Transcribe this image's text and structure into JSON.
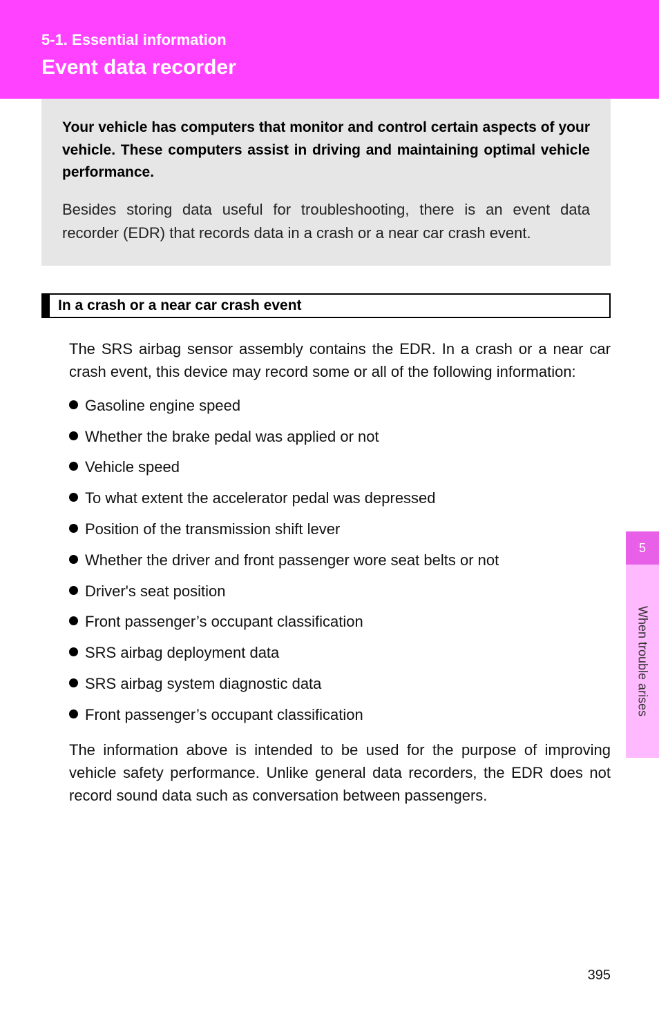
{
  "header": {
    "chapter": "5-1. Essential information",
    "title": "Event data recorder"
  },
  "intro": {
    "bold": "Your vehicle has computers that monitor and control certain aspects of your vehicle. These computers assist in driving and maintaining optimal vehicle performance.",
    "para": "Besides storing data useful for troubleshooting, there is an event data recorder (EDR) that records data in a crash or a near car crash event."
  },
  "subhead": "In a crash or a near car crash event",
  "body": {
    "lead": "The SRS airbag sensor assembly contains the EDR. In a crash or a near car crash event, this device may record some or all of the following information:",
    "bullets": [
      "Gasoline engine speed",
      "Whether the brake pedal was applied or not",
      "Vehicle speed",
      "To what extent the accelerator pedal was depressed",
      "Position of the transmission shift lever",
      "Whether the driver and front passenger wore seat belts or not",
      "Driver's seat position",
      "Front passenger’s occupant classification",
      "SRS airbag deployment data",
      "SRS airbag system diagnostic data",
      "Front passenger’s occupant classification"
    ],
    "closing": "The information above is intended to be used for the purpose of improving vehicle safety performance. Unlike general data recorders, the EDR does not record sound data such as conversation between passengers."
  },
  "sidetab": {
    "num": "5",
    "label": "When trouble arises"
  },
  "page_number": "395"
}
